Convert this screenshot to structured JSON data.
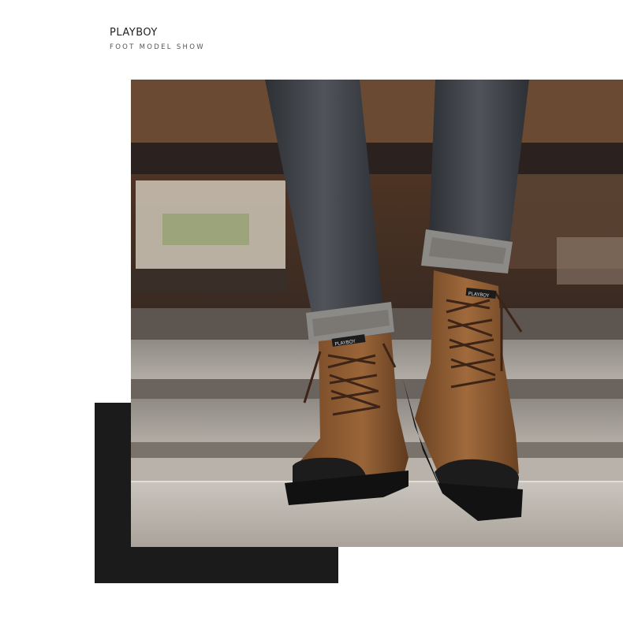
{
  "header": {
    "brand": "PLAYBOY",
    "subtitle": "FOOT MODEL SHOW"
  },
  "photo": {
    "subject": "boots-on-stairs-photo",
    "tongue_label": "PLAYBOY"
  },
  "colors": {
    "background": "#ffffff",
    "accent_block": "#1b1b1b",
    "leather": "#8a5a32",
    "denim": "#3c3f44"
  }
}
